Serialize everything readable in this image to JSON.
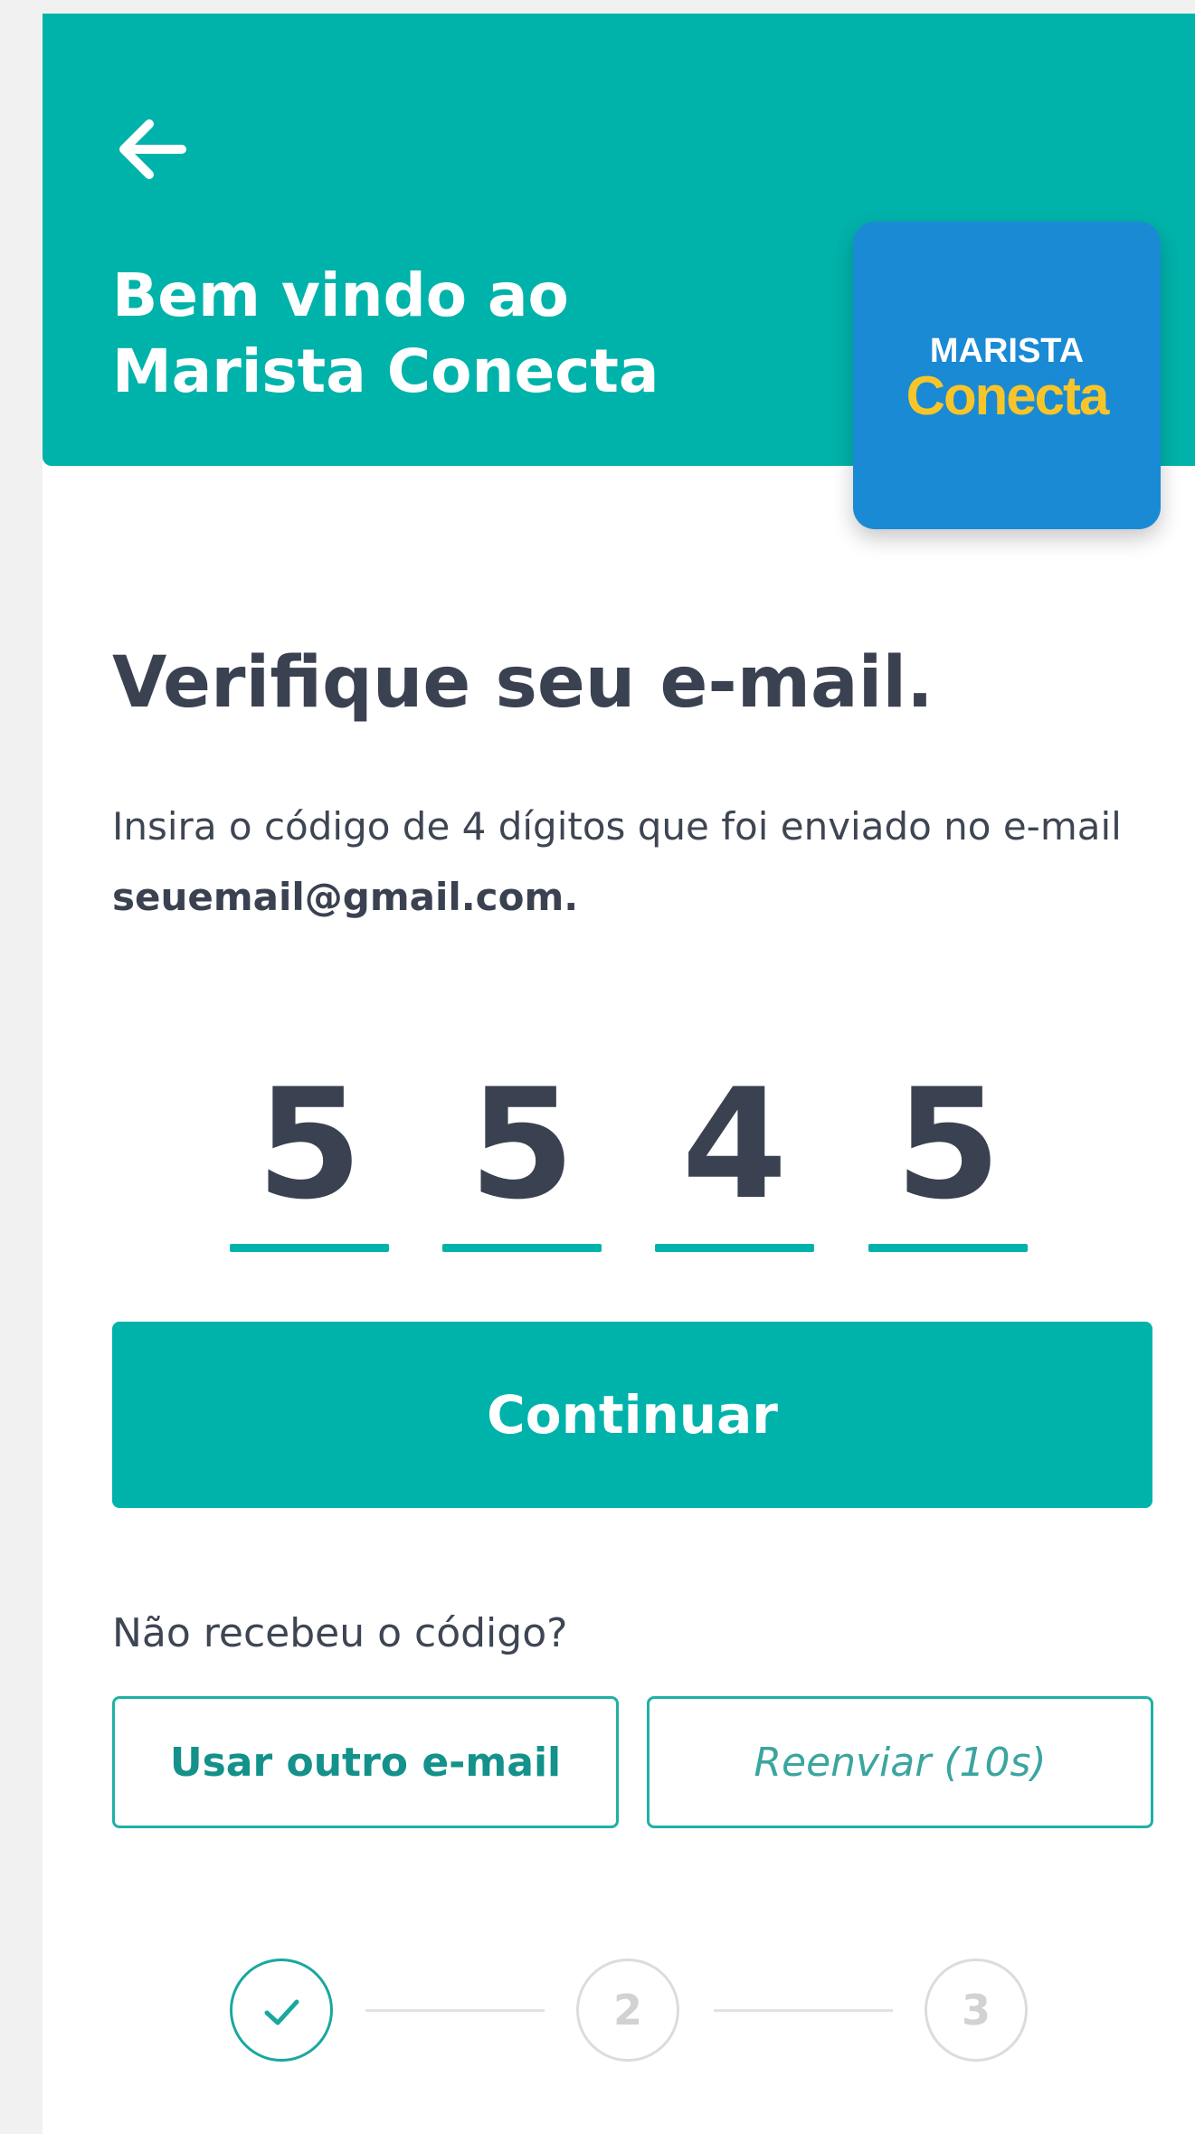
{
  "header": {
    "title_line1": "Bem vindo ao",
    "title_line2": "Marista Conecta",
    "back_icon": "arrow-left-icon",
    "logo": {
      "line1": "MARISTA",
      "line2": "Conecta"
    }
  },
  "main": {
    "title": "Verifique seu e-mail.",
    "instructions_text": "Insira o código de 4 dígitos que foi enviado no e-mail ",
    "email": "seuemail@gmail.com.",
    "code_digits": [
      "5",
      "5",
      "4",
      "5"
    ],
    "continue_label": "Continuar",
    "not_received": "Não recebeu o código?",
    "other_email_label": "Usar outro e-mail",
    "resend_label": "Reenviar (10s)"
  },
  "stepper": {
    "step1_icon": "check-icon",
    "step2": "2",
    "step3": "3"
  },
  "colors": {
    "accent": "#00b3aa",
    "logo_bg": "#1a8ad4",
    "logo_yellow": "#f7c52a",
    "text_dark": "#3a4150"
  }
}
